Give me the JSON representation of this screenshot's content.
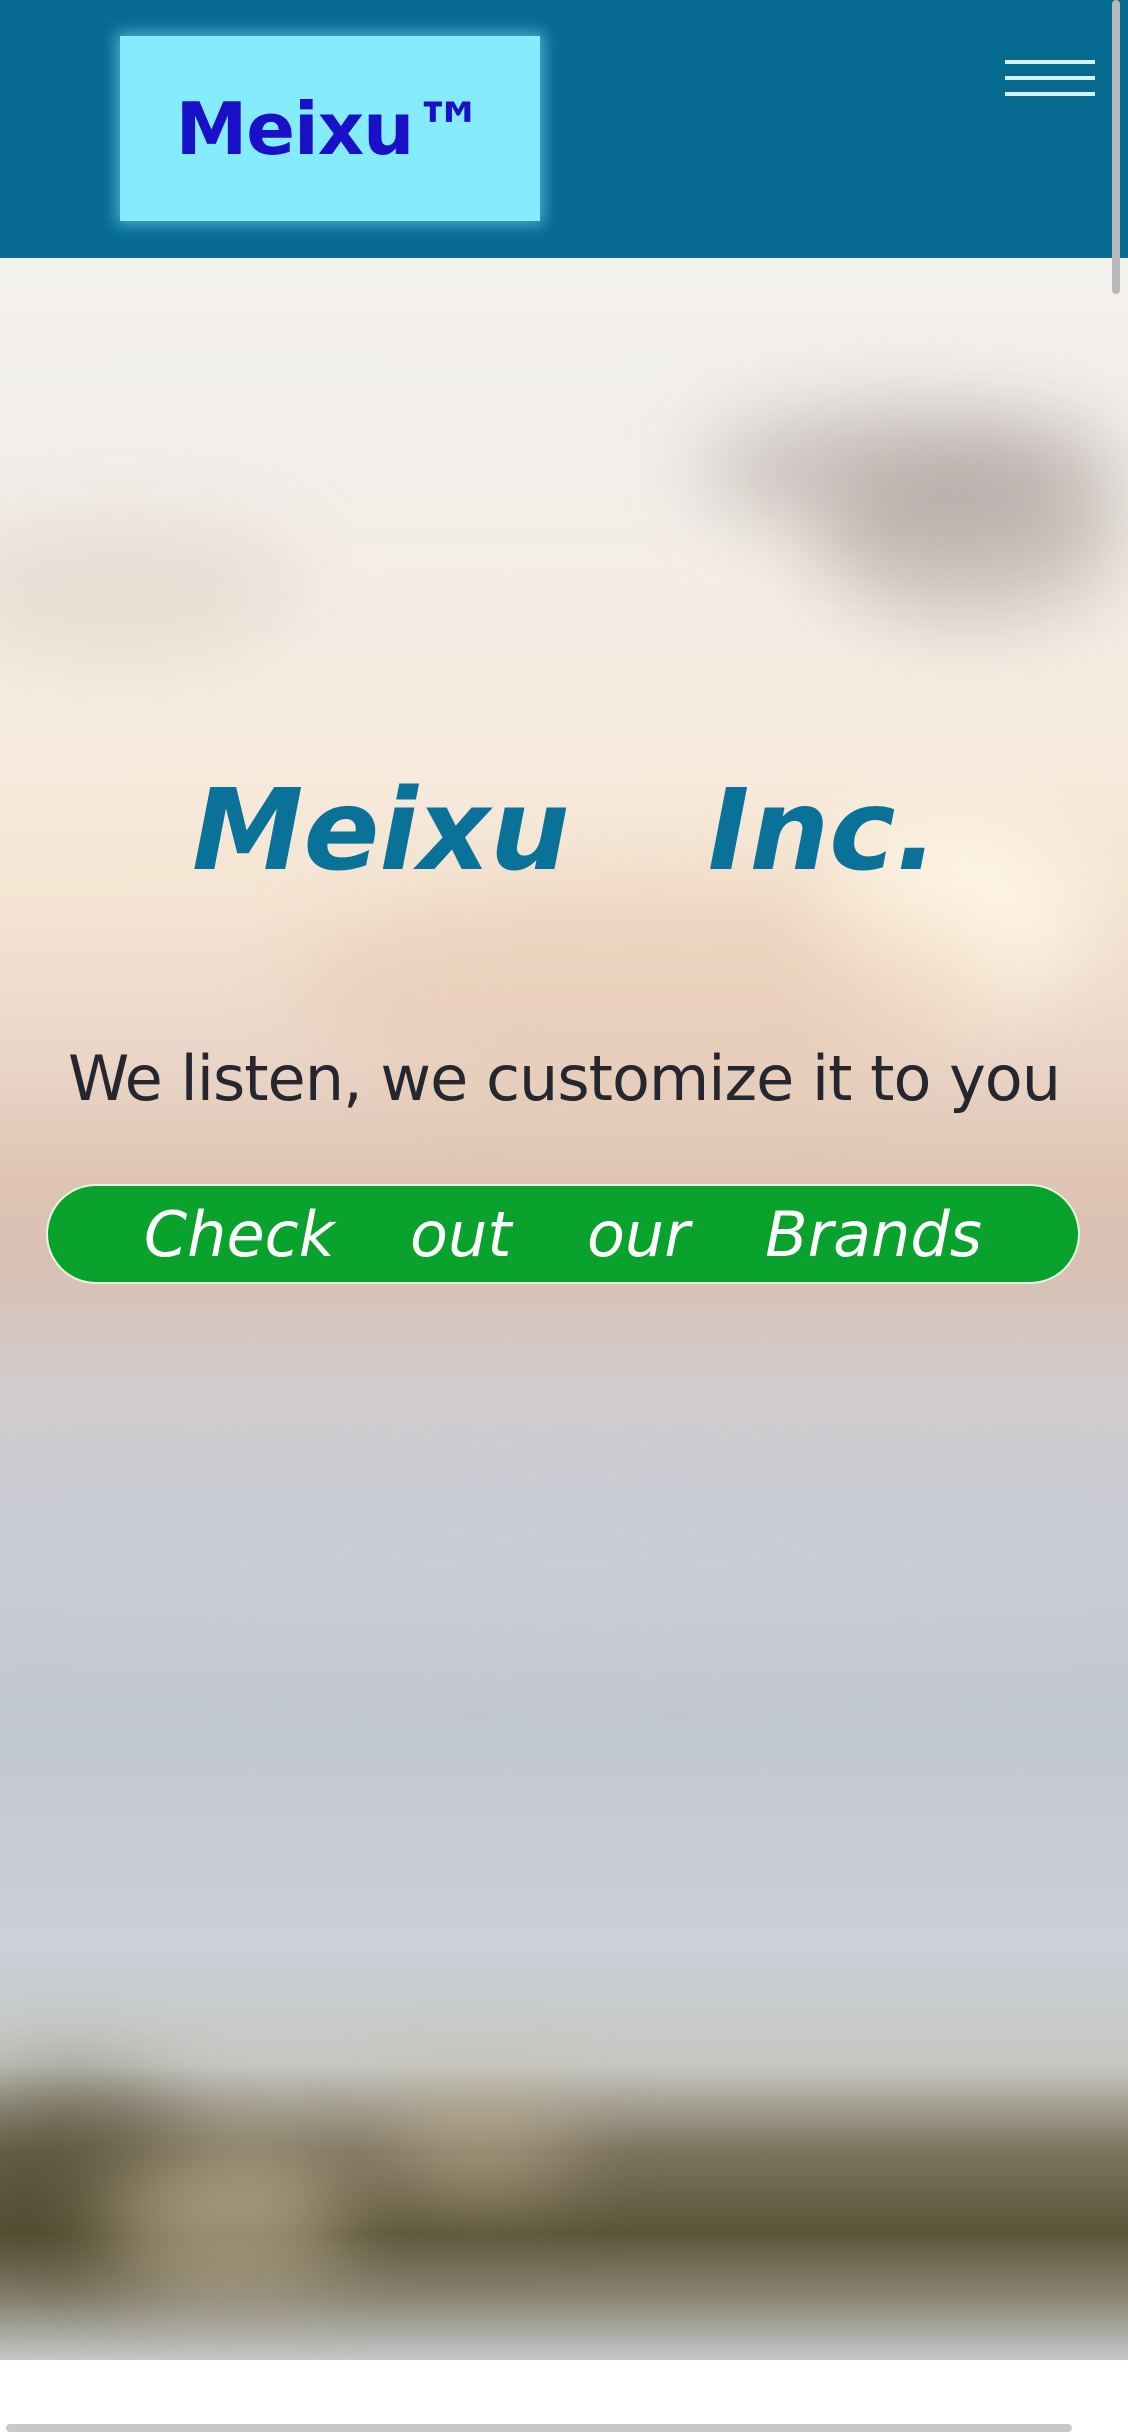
{
  "header": {
    "logo_text": "Meixu™",
    "menu_icon": "hamburger-menu-icon"
  },
  "hero": {
    "title": "Meixu  Inc.",
    "tagline": "We listen, we customize it to you",
    "cta_label": "Check  out  our  Brands"
  },
  "colors": {
    "header_bg": "#076b91",
    "logo_bg": "#85ecfe",
    "logo_text": "#1a10c8",
    "title": "#0a7298",
    "tagline": "#26262e",
    "cta_bg": "#09a22c",
    "cta_text": "#ffffff"
  }
}
